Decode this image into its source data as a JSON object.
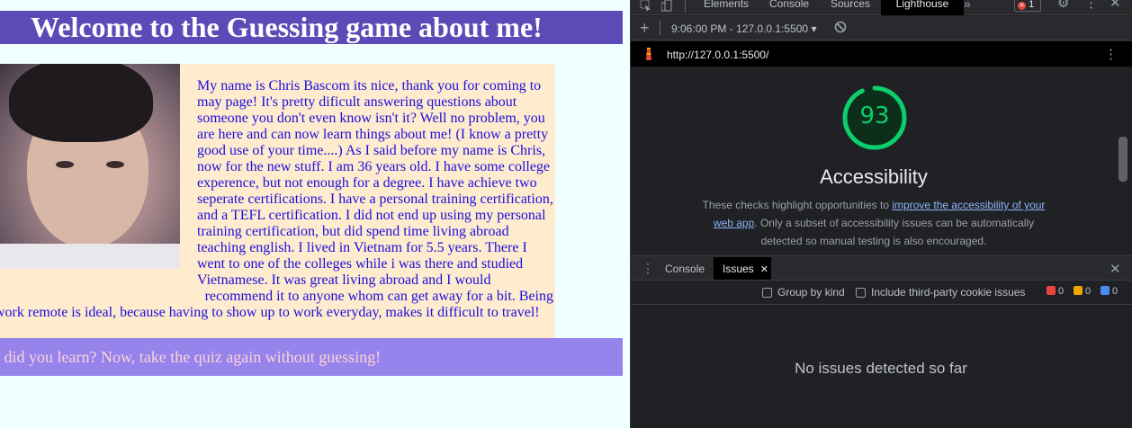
{
  "page": {
    "title": "Welcome to the Guessing game about me!",
    "bio_main": "My name is Chris Bascom its nice, thank you for coming to may page! It's pretty dificult answering questions about someone you don't even know isn't it? Well no problem, you are here and can now learn things about me! (I know a pretty good use of your time....) As I said before my name is Chris, now for the new stuff. I am 36 years old. I have some college experence, but not enough for a degree. I have achieve two seperate certifications. I have a personal training certification, and a TEFL certification. I did not end up using my personal training certification, but did spend time living abroad teaching english. I lived in Vietnam for 5.5 years. There I went to one of the colleges while i was there and studied Vietnamese. It was great living abroad and I would",
    "bio_tail_1": "recommend it to anyone whom can get away for a bit. Being",
    "bio_tail_2": "work remote is ideal, because having to show up to work everyday, makes it difficult to travel!",
    "quiz_prompt": "hat did you learn? Now, take the quiz again without guessing!"
  },
  "devtools": {
    "tabs": [
      "Elements",
      "Console",
      "Sources",
      "Lighthouse"
    ],
    "active_tab": "Lighthouse",
    "more_tabs": "»",
    "error_count": "1",
    "report_time": "9:06:00 PM - 127.0.0.1:5500 ▾",
    "report_url": "http://127.0.0.1:5500/",
    "score": "93",
    "category": "Accessibility",
    "desc_before": "These checks highlight opportunities to ",
    "desc_link": "improve the accessibility of your web app",
    "desc_after": ". Only a subset of accessibility issues can be automatically detected so manual testing is also encouraged.",
    "drawer_tabs": [
      "Console",
      "Issues"
    ],
    "active_drawer_tab": "Issues",
    "group_by_kind": "Group by kind",
    "third_party": "Include third-party cookie issues",
    "issue_counts": {
      "errors": "0",
      "warnings": "0",
      "info": "0"
    },
    "empty_message": "No issues detected so far",
    "colors": {
      "accent_green": "#0cce6b",
      "link": "#8ab4f8",
      "error": "#e8453c",
      "warning": "#f2a600",
      "info": "#4c8bf5"
    }
  }
}
